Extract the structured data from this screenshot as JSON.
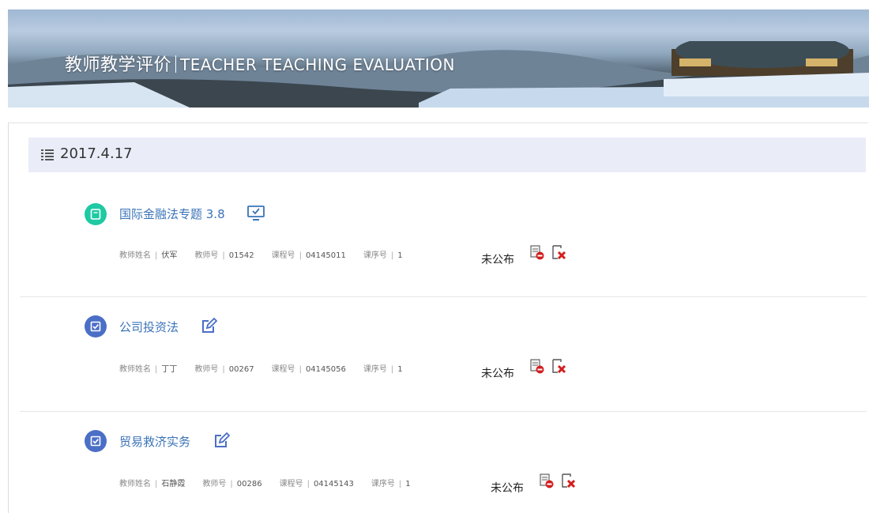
{
  "banner": {
    "title_cn": "教师教学评价",
    "title_en": "TEACHER TEACHING EVALUATION"
  },
  "date_group": {
    "date": "2017.4.17"
  },
  "labels": {
    "teacher_name": "教师姓名",
    "teacher_no": "教师号",
    "course_no": "课程号",
    "section_no": "课序号"
  },
  "courses": [
    {
      "title": "国际金融法专题 3.8",
      "icon": "book-icon",
      "icon_color": "#1fc9a3",
      "action_icon": "monitor-icon",
      "teacher_name": "伏军",
      "teacher_no": "01542",
      "course_no": "04145011",
      "section_no": "1",
      "status": "未公布"
    },
    {
      "title": "公司投资法",
      "icon": "checkbox-icon",
      "icon_color": "#4b6fc6",
      "action_icon": "edit-icon",
      "teacher_name": "丁丁",
      "teacher_no": "00267",
      "course_no": "04145056",
      "section_no": "1",
      "status": "未公布"
    },
    {
      "title": "贸易救济实务",
      "icon": "checkbox-icon",
      "icon_color": "#4b6fc6",
      "action_icon": "edit-icon",
      "teacher_name": "石静霞",
      "teacher_no": "00286",
      "course_no": "04145143",
      "section_no": "1",
      "status": "未公布"
    }
  ],
  "colors": {
    "accent_blue": "#3a73b8",
    "date_bar_bg": "#eaedf8",
    "delete_red": "#d21e1e"
  }
}
